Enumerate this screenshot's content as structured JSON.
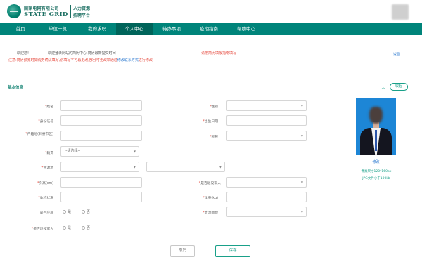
{
  "header": {
    "company_cn": "国家电网有限公司",
    "company_en": "STATE GRID",
    "platform_line1": "人力资源",
    "platform_line2": "招聘平台"
  },
  "nav": {
    "items": [
      {
        "label": "首页"
      },
      {
        "label": "单位一览"
      },
      {
        "label": "我的求职"
      },
      {
        "label": "个人中心"
      },
      {
        "label": "待办事项"
      },
      {
        "label": "疫期指南"
      },
      {
        "label": "帮助中心"
      }
    ],
    "active": "个人中心"
  },
  "notice": {
    "welcome": "欢迎您!",
    "intro": "欢迎登录网站的简历中心,简历最新提交时间",
    "fill_warning": "请按简历填报指南填写",
    "note_red": "注意:简历预览时如请务确认填写,别填写不可再更改,部分可更改项通过",
    "note_link": "修改联系方式",
    "note_end": "进行修改",
    "back_link": "返回"
  },
  "section": {
    "title": "基本信息",
    "collapse_label": "展开/收起",
    "fold_button": "收起"
  },
  "form": {
    "name_label": "姓名",
    "gender_label": "性别",
    "id_label": "身份证号",
    "birth_label": "出生日期",
    "hometown_label": "户籍地(到县市区)",
    "ethnicity_label": "民族",
    "origin_label": "籍贯",
    "origin_placeholder": "--请选择--",
    "birthplace_label": "生源地",
    "height_label": "身高(cm)",
    "health_label": "体检状况",
    "weight_label": "体重(kg)",
    "marital_label": "婚姻状况",
    "political_label": "政治面貌",
    "is_major_label": "是否应届",
    "is_cadre_label": "是否退役军人",
    "yes": "是",
    "no": "否"
  },
  "photo": {
    "edit_link": "修改",
    "hint1": "像素尺寸120*160px",
    "hint2": "JPG文件小于100kb"
  },
  "buttons": {
    "cancel": "取消",
    "save": "保存"
  }
}
